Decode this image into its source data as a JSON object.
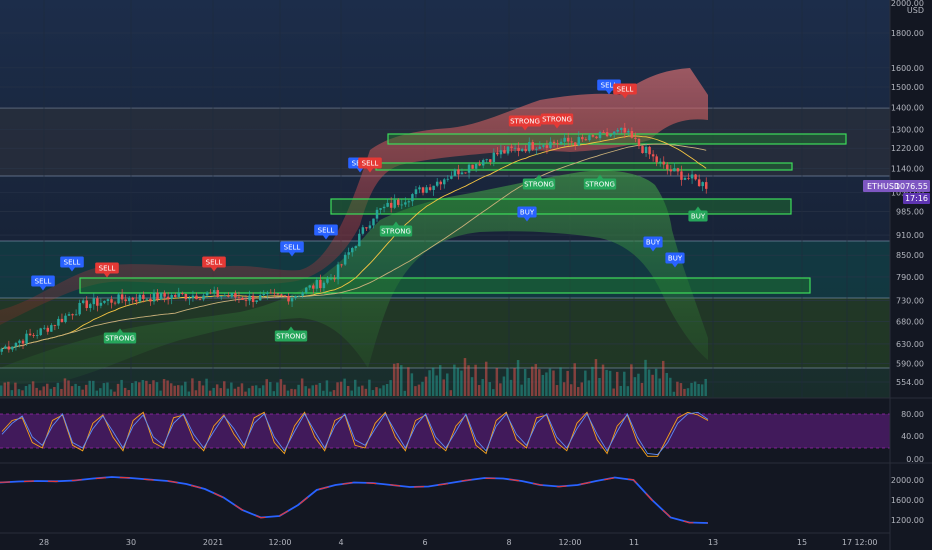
{
  "symbol_label": "ETHUSD",
  "last_price": "1076.55",
  "countdown": "17:16",
  "currency": "USD",
  "top_price_tick": "2000.00",
  "price_ticks": [
    1800,
    1600,
    1500,
    1400,
    1300,
    1220,
    1140,
    1050,
    985,
    910,
    850,
    790,
    730,
    680,
    630,
    590,
    554
  ],
  "price_tick_labels": [
    "1800.00",
    "1600.00",
    "1500.00",
    "1400.00",
    "1300.00",
    "1220.00",
    "1140.00",
    "1050.00",
    "985.00",
    "910.00",
    "850.00",
    "790.00",
    "730.00",
    "680.00",
    "630.00",
    "590.00",
    "554.00"
  ],
  "time_ticks": [
    "28",
    "30",
    "2021",
    "12:00",
    "4",
    "6",
    "8",
    "12:00",
    "11",
    "13",
    "15",
    "17",
    "12:00"
  ],
  "stoch_ticks": [
    "80.00",
    "40.00",
    "0.00"
  ],
  "osc_ticks": [
    "2000.00",
    "1600.00",
    "1200.00"
  ],
  "chart_data": [
    {
      "type": "line",
      "title": "",
      "xlabel": "",
      "ylabel": "",
      "y_scale": "log",
      "ylim": [
        540,
        2000
      ],
      "x": [
        "12-26",
        "12-27",
        "12-28",
        "12-29",
        "12-30",
        "12-31",
        "01-01",
        "01-02",
        "01-03",
        "01-04",
        "01-05",
        "01-06",
        "01-07",
        "01-08",
        "01-09",
        "01-10",
        "01-11",
        "01-12"
      ],
      "series": [
        {
          "values": [
            620,
            660,
            720,
            735,
            740,
            745,
            735,
            740,
            790,
            980,
            1050,
            1130,
            1200,
            1240,
            1250,
            1290,
            1140,
            1076
          ]
        }
      ],
      "signals": [
        {
          "label": "SELL",
          "color": "#2962ff"
        },
        {
          "label": "SELL",
          "color": "#2962ff"
        },
        {
          "label": "SELL",
          "color": "#e53935"
        },
        {
          "label": "SELL",
          "color": "#e53935"
        },
        {
          "label": "SELL",
          "color": "#2962ff"
        },
        {
          "label": "SELL",
          "color": "#2962ff"
        },
        {
          "label": "SELL",
          "color": "#2962ff"
        },
        {
          "label": "SELL",
          "color": "#e53935"
        },
        {
          "label": "STRONG",
          "color": "#e53935"
        },
        {
          "label": "STRONG",
          "color": "#e53935"
        },
        {
          "label": "SELL",
          "color": "#2962ff"
        },
        {
          "label": "SELL",
          "color": "#e53935"
        },
        {
          "label": "STRONG",
          "color": "#26a65b"
        },
        {
          "label": "STRONG",
          "color": "#26a65b"
        },
        {
          "label": "STRONG",
          "color": "#26a65b"
        },
        {
          "label": "STRONG",
          "color": "#26a65b"
        },
        {
          "label": "STRONG",
          "color": "#26a65b"
        },
        {
          "label": "BUY",
          "color": "#2962ff"
        },
        {
          "label": "BUY",
          "color": "#2962ff"
        },
        {
          "label": "BUY",
          "color": "#2962ff"
        },
        {
          "label": "BUY",
          "color": "#26a65b"
        }
      ]
    },
    {
      "type": "line",
      "title": "",
      "ylim": [
        0,
        100
      ],
      "series": [
        {
          "color": "#f7a21b",
          "values": [
            50,
            70,
            75,
            30,
            20,
            70,
            80,
            25,
            15,
            65,
            80,
            40,
            15,
            70,
            85,
            30,
            20,
            75,
            80,
            35,
            15,
            60,
            80,
            45,
            20,
            75,
            85,
            30,
            10,
            60,
            85,
            40,
            15,
            70,
            80,
            25,
            20,
            65,
            85,
            40,
            15,
            70,
            80,
            30,
            15,
            60,
            80,
            25,
            10,
            70,
            85,
            35,
            20,
            75,
            80,
            30,
            15,
            65,
            85,
            35,
            10,
            60,
            80,
            30,
            5,
            5,
            40,
            75,
            85,
            80,
            70
          ]
        },
        {
          "color": "#5b8bf7",
          "values": [
            45,
            65,
            78,
            40,
            25,
            60,
            82,
            30,
            20,
            55,
            78,
            50,
            20,
            60,
            80,
            40,
            25,
            65,
            82,
            45,
            20,
            50,
            78,
            55,
            25,
            65,
            82,
            40,
            15,
            50,
            82,
            50,
            20,
            60,
            82,
            35,
            25,
            55,
            82,
            50,
            20,
            60,
            82,
            40,
            20,
            50,
            82,
            35,
            15,
            60,
            82,
            45,
            25,
            65,
            82,
            40,
            20,
            55,
            82,
            45,
            15,
            50,
            82,
            40,
            10,
            8,
            30,
            65,
            82,
            85,
            72
          ]
        }
      ]
    },
    {
      "type": "line",
      "title": "",
      "ylim": [
        1050,
        2150
      ],
      "series": [
        {
          "color": "#2962ff",
          "values": [
            1950,
            1970,
            1980,
            1975,
            1990,
            2030,
            2060,
            2040,
            2010,
            1980,
            1920,
            1820,
            1650,
            1400,
            1250,
            1280,
            1500,
            1800,
            1900,
            1950,
            1940,
            1900,
            1860,
            1870,
            1930,
            1990,
            2040,
            2030,
            1980,
            1900,
            1870,
            1900,
            1980,
            2050,
            2000,
            1600,
            1250,
            1150,
            1140
          ]
        },
        {
          "color": "#e53935",
          "values": [
            1955,
            1965,
            1985,
            1970,
            1995,
            2025,
            2055,
            2045,
            2005,
            1985,
            1915,
            1825,
            1645,
            1405,
            1245,
            1285,
            1495,
            1805,
            1895,
            1955,
            1935,
            1905,
            1855,
            1875,
            1925,
            1995,
            2035,
            2035,
            1975,
            1905,
            1865,
            1905,
            1975,
            2045,
            2005,
            1595,
            1255,
            1145,
            1145
          ]
        }
      ]
    }
  ]
}
